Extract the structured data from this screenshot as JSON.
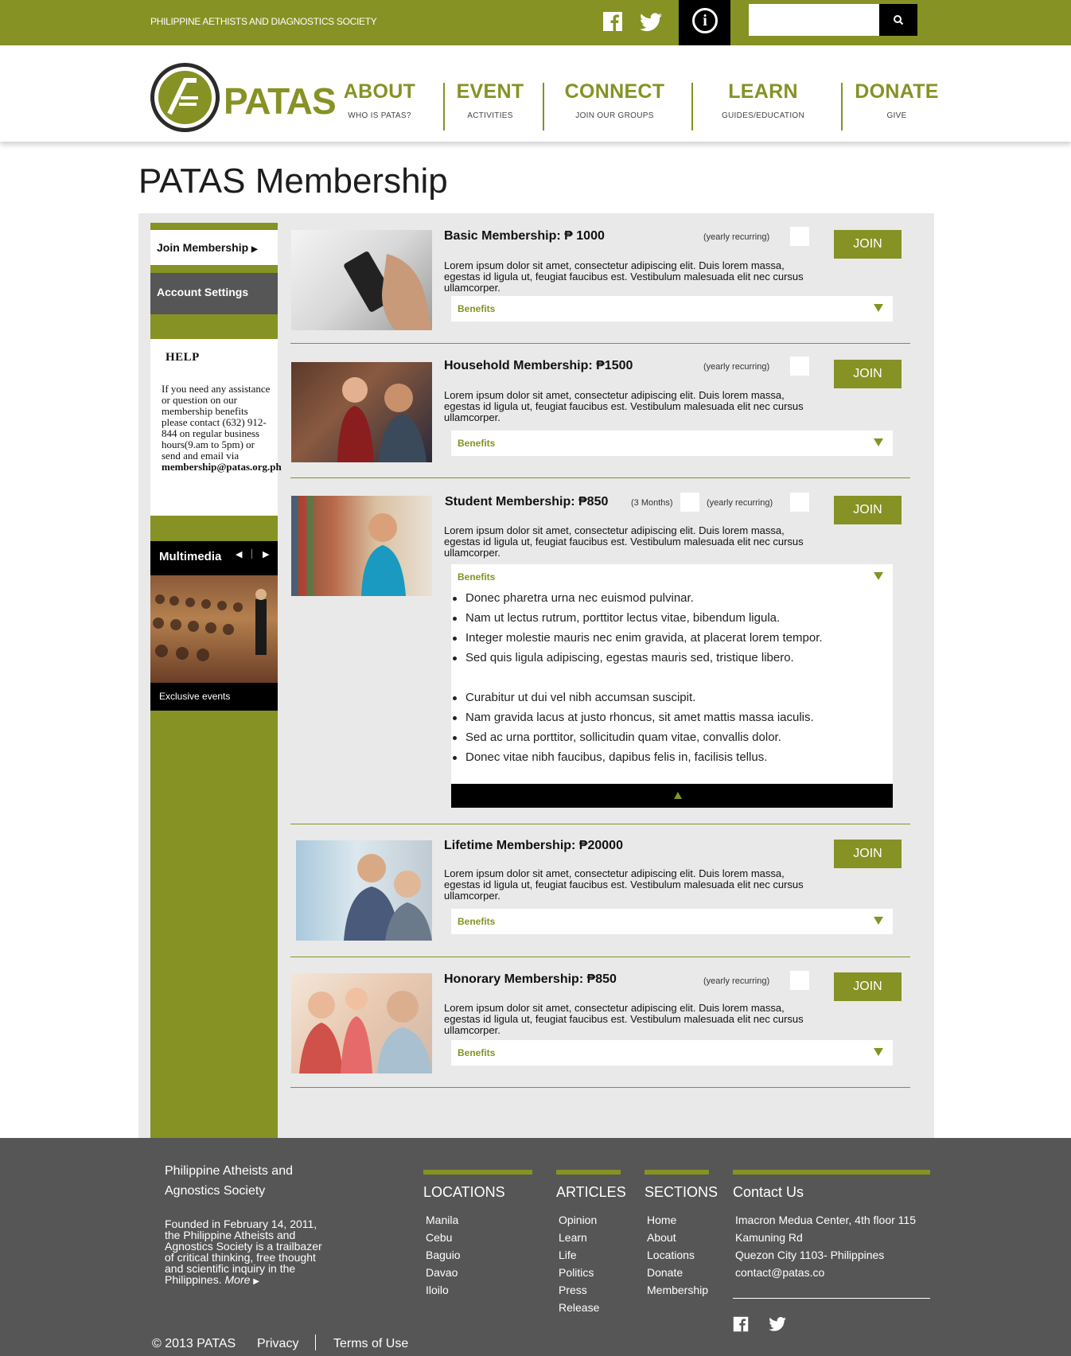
{
  "topbar": {
    "org_name": "PHILIPPINE AETHISTS AND DIAGNOSTICS SOCIETY",
    "search_placeholder": ""
  },
  "logo": {
    "text": "PATAS"
  },
  "nav": [
    {
      "label": "ABOUT",
      "sub": "WHO IS PATAS?"
    },
    {
      "label": "EVENT",
      "sub": "ACTIVITIES"
    },
    {
      "label": "CONNECT",
      "sub": "JOIN OUR GROUPS"
    },
    {
      "label": "LEARN",
      "sub": "GUIDES/EDUCATION"
    },
    {
      "label": "DONATE",
      "sub": "GIVE"
    }
  ],
  "page_title": "PATAS Membership",
  "sidebar": {
    "join_membership": "Join Membership",
    "account_settings": "Account Settings",
    "help_title": "HELP",
    "help_text": "If you need any assistance or question on our membership benefits please contact (632) 912-844 on regular business hours(9.am to 5pm) or send and email via",
    "help_email": "membership@patas.org.ph",
    "multimedia_title": "Multimedia",
    "multimedia_caption": "Exclusive events"
  },
  "memberships": [
    {
      "title": "Basic Membership: ₱ 1000",
      "recurring": "(yearly recurring)",
      "join": "JOIN",
      "benefits": "Benefits"
    },
    {
      "title": "Household Membership: ₱1500",
      "recurring": "(yearly recurring)",
      "join": "JOIN",
      "benefits": "Benefits"
    },
    {
      "title": "Student Membership: ₱850",
      "months": "(3 Months)",
      "recurring": "(yearly recurring)",
      "join": "JOIN",
      "benefits": "Benefits"
    },
    {
      "title": "Lifetime Membership: ₱20000",
      "join": "JOIN",
      "benefits": "Benefits"
    },
    {
      "title": "Honorary Membership: ₱850",
      "recurring": "(yearly recurring)",
      "join": "JOIN",
      "benefits": "Benefits"
    }
  ],
  "description": "Lorem ipsum dolor sit amet, consectetur adipiscing elit. Duis lorem massa, egestas id ligula ut, feugiat faucibus est. Vestibulum malesuada elit nec cursus ullamcorper.",
  "benefit_items": [
    "Donec pharetra urna nec euismod pulvinar.",
    "Nam ut lectus rutrum, porttitor lectus vitae, bibendum ligula.",
    "Integer molestie mauris nec enim gravida, at placerat lorem tempor.",
    "Sed quis ligula adipiscing, egestas mauris sed, tristique libero.",
    "Curabitur ut dui vel nibh accumsan suscipit.",
    "Nam gravida lacus at justo rhoncus, sit amet mattis massa iaculis.",
    "Sed ac urna porttitor, sollicitudin quam vitae, convallis dolor.",
    "Donec vitae nibh faucibus, dapibus felis in, facilisis tellus."
  ],
  "footer": {
    "org": "Philippine Atheists and Agnostics Society",
    "about": "Founded in February 14, 2011, the Philippine Atheists and Agnostics Society is a trailbazer of critical thinking, free thought and scientific inquiry in the Philippines.",
    "more": "More",
    "locations_title": "LOCATIONS",
    "locations": [
      "Manila",
      "Cebu",
      "Baguio",
      "Davao",
      "Iloilo"
    ],
    "articles_title": "ARTICLES",
    "articles": [
      "Opinion",
      "Learn",
      "Life",
      "Politics",
      "Press",
      "Release"
    ],
    "sections_title": "SECTIONS",
    "sections": [
      "Home",
      "About",
      "Locations",
      "Donate",
      "Membership"
    ],
    "contact_title": "Contact Us",
    "contact": [
      "Imacron Medua Center, 4th floor 115",
      "Kamuning Rd",
      "Quezon City 1103- Philippines",
      "contact@patas.co"
    ],
    "copyright": "© 2013 PATAS",
    "privacy": "Privacy",
    "terms": "Terms of Use"
  },
  "colors": {
    "brand": "#869223",
    "dark": "#565656"
  }
}
